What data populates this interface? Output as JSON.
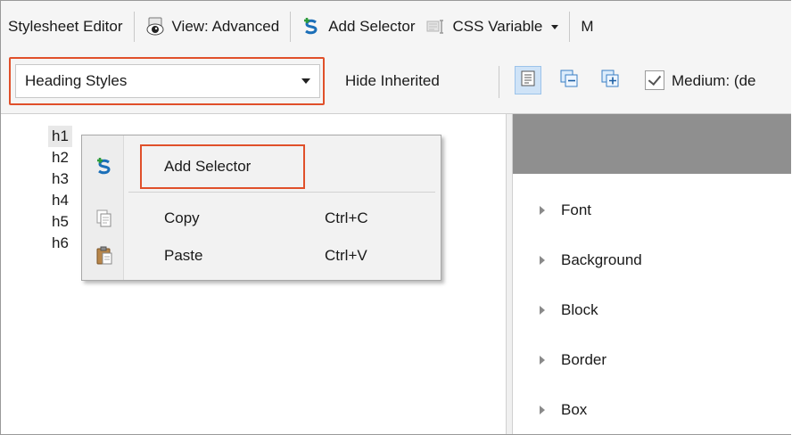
{
  "toolbar": {
    "title": "Stylesheet Editor",
    "view_label": "View: Advanced",
    "add_selector_label": "Add Selector",
    "css_variable_label": "CSS Variable",
    "more_label": "M"
  },
  "toolbar2": {
    "stylesheet_select": "Heading Styles",
    "hide_inherited_label": "Hide Inherited",
    "medium_label": "Medium: (de"
  },
  "selectors": [
    "h1",
    "h2",
    "h3",
    "h4",
    "h5",
    "h6"
  ],
  "context_menu": {
    "add_selector": "Add Selector",
    "copy": "Copy",
    "copy_shortcut": "Ctrl+C",
    "paste": "Paste",
    "paste_shortcut": "Ctrl+V"
  },
  "property_categories": [
    "Font",
    "Background",
    "Block",
    "Border",
    "Box"
  ],
  "colors": {
    "highlight": "#e0502a",
    "header_bar": "#8f8f8f"
  },
  "icons": [
    "view-eye-icon",
    "add-selector-icon",
    "css-variable-icon",
    "chevron-down-icon",
    "properties-view-icon",
    "collapse-icon",
    "expand-icon",
    "checkbox-icon",
    "copy-icon",
    "paste-icon"
  ]
}
